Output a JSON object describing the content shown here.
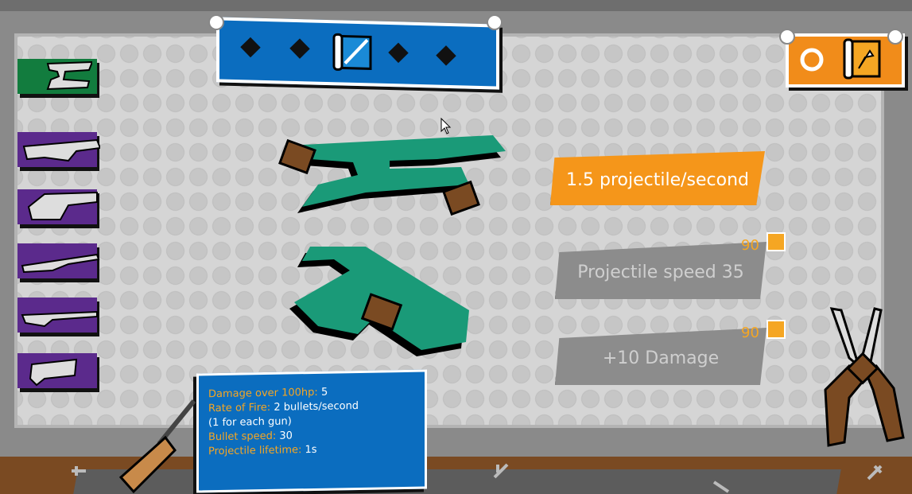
{
  "banner": {
    "icon": "scroll-rifle-icon",
    "color": "#0b6dbf"
  },
  "top_right": {
    "primary_icon": "circle-icon",
    "secondary_icon": "scroll-upgrade-icon",
    "color": "#f18c1a"
  },
  "weapon_slots": [
    {
      "icon": "double-gun-icon",
      "active": true
    },
    {
      "icon": "minigun-icon",
      "active": false
    },
    {
      "icon": "heavy-gun-icon",
      "active": false
    },
    {
      "icon": "rifle-icon",
      "active": false
    },
    {
      "icon": "sniper-icon",
      "active": false
    },
    {
      "icon": "shotgun-icon",
      "active": false
    }
  ],
  "upgrades": {
    "current": {
      "label": "1.5 projectile/second"
    },
    "option1": {
      "label": "Projectile speed 35",
      "cost": "90"
    },
    "option2": {
      "label": "+10 Damage",
      "cost": "90"
    }
  },
  "info": {
    "damage_key": "Damage over 100hp:",
    "damage_val": "5",
    "rof_key": "Rate of Fire:",
    "rof_val": "2 bullets/second",
    "rof_note": "(1 for each gun)",
    "speed_key": "Bullet speed:",
    "speed_val": "30",
    "life_key": "Projectile lifetime:",
    "life_val": "1s"
  },
  "colors": {
    "accent_orange": "#f5961a",
    "panel_blue": "#0b6dbf",
    "weapon_green": "#1a9a78",
    "slot_purple": "#5b2a8c",
    "slot_active": "#127c3e"
  }
}
